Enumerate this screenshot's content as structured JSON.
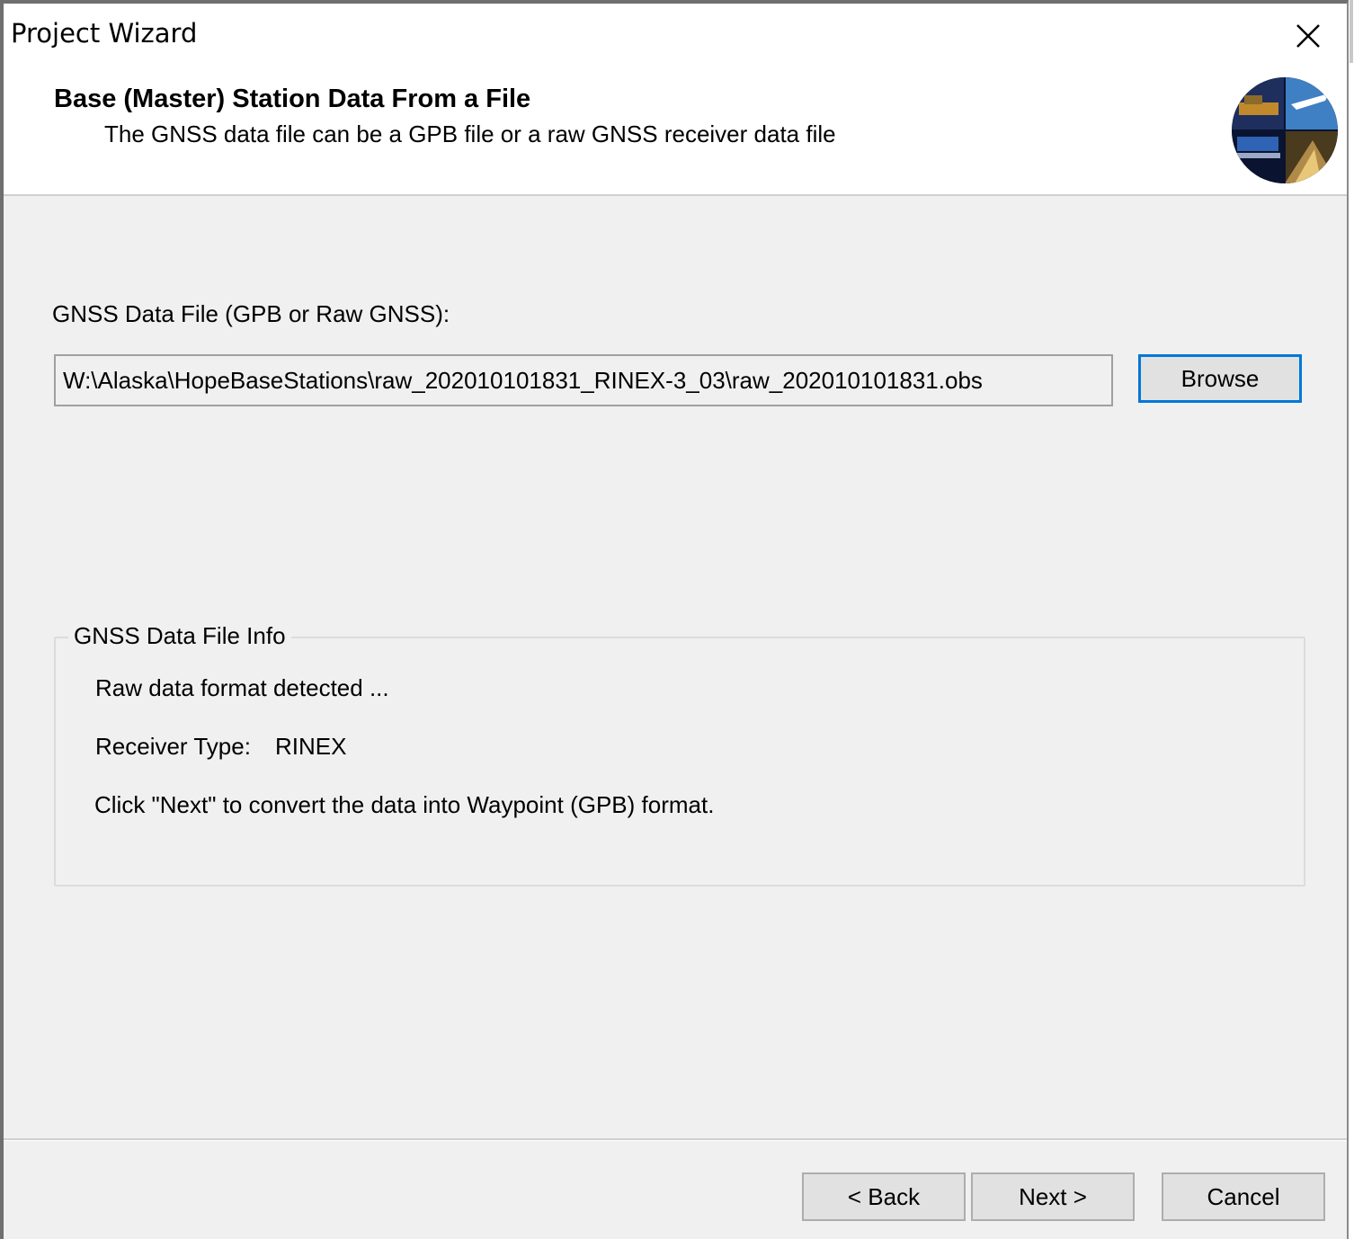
{
  "window": {
    "title": "Project Wizard",
    "close_icon": "close-icon"
  },
  "header": {
    "step_title": "Base (Master) Station Data From a File",
    "step_subtitle": "The GNSS data file can be a GPB file or a raw GNSS receiver data file",
    "logo_icon": "wizard-logo-icon"
  },
  "file": {
    "label": "GNSS Data File (GPB or Raw GNSS):",
    "path": "W:\\Alaska\\HopeBaseStations\\raw_202010101831_RINEX-3_03\\raw_202010101831.obs",
    "browse_label": "Browse"
  },
  "info": {
    "legend": "GNSS Data File Info",
    "format_line": "Raw data format detected ...",
    "receiver_label": "Receiver Type:",
    "receiver_value": "RINEX",
    "instruction": "Click \"Next\" to convert the data into Waypoint (GPB) format."
  },
  "footer": {
    "back_label": "< Back",
    "next_label": "Next >",
    "cancel_label": "Cancel"
  },
  "colors": {
    "focus_accent": "#0078d7",
    "dialog_bg": "#f0f0f0",
    "header_bg": "#ffffff"
  }
}
